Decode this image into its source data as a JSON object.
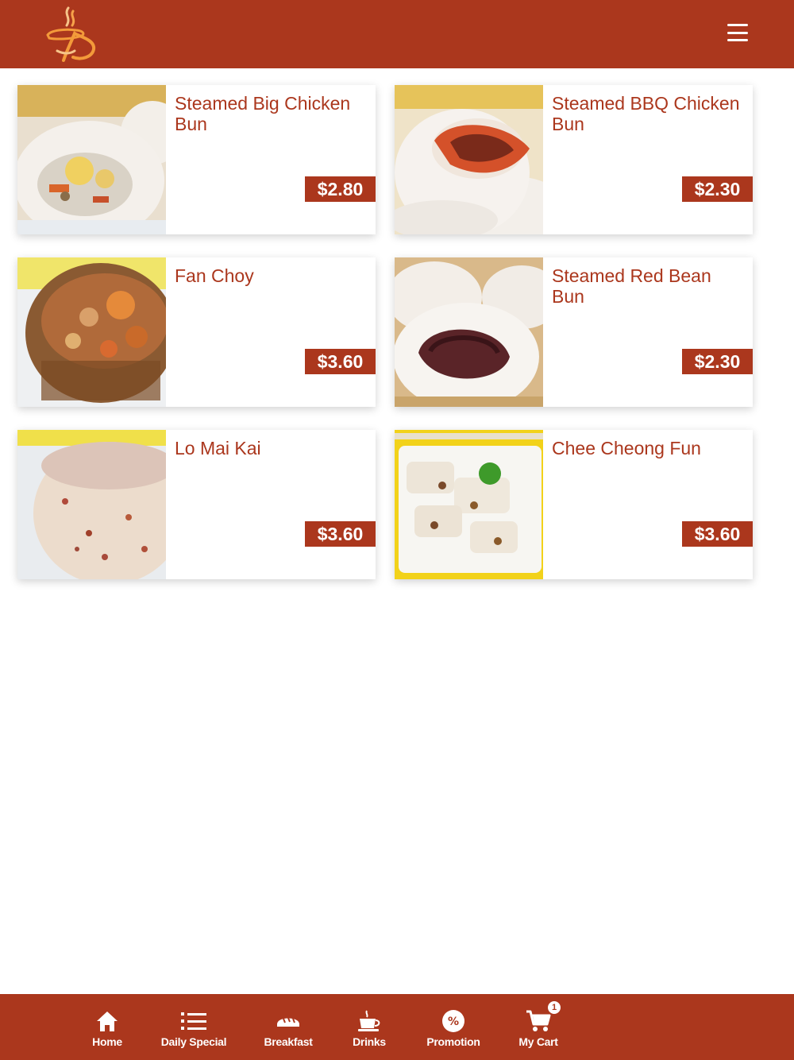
{
  "header": {
    "logo_icon": "steaming-cup-logo",
    "menu_icon": "hamburger-menu-icon"
  },
  "colors": {
    "brand": "#ab371d",
    "background": "#ffffff"
  },
  "items": [
    {
      "name": "Steamed Big Chicken Bun",
      "price": "$2.80",
      "image": "steamed-big-chicken-bun-photo"
    },
    {
      "name": "Steamed BBQ Chicken Bun",
      "price": "$2.30",
      "image": "steamed-bbq-chicken-bun-photo"
    },
    {
      "name": "Fan Choy",
      "price": "$3.60",
      "image": "fan-choy-photo"
    },
    {
      "name": "Steamed Red Bean Bun",
      "price": "$2.30",
      "image": "steamed-red-bean-bun-photo"
    },
    {
      "name": "Lo Mai Kai",
      "price": "$3.60",
      "image": "lo-mai-kai-photo"
    },
    {
      "name": "Chee Cheong Fun",
      "price": "$3.60",
      "image": "chee-cheong-fun-photo"
    }
  ],
  "nav": {
    "items": [
      {
        "label": "Home",
        "icon": "home-icon"
      },
      {
        "label": "Daily Special",
        "icon": "list-icon"
      },
      {
        "label": "Breakfast",
        "icon": "bread-icon"
      },
      {
        "label": "Drinks",
        "icon": "coffee-cup-icon"
      },
      {
        "label": "Promotion",
        "icon": "percent-badge-icon"
      },
      {
        "label": "My Cart",
        "icon": "cart-icon"
      }
    ],
    "cart_count": "1"
  }
}
